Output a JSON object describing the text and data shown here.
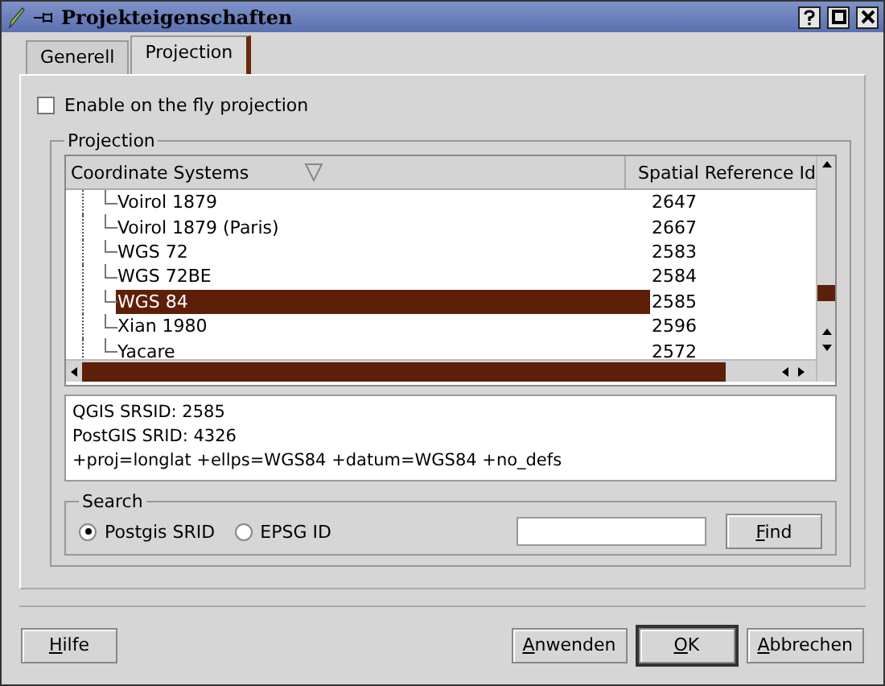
{
  "window": {
    "title": "Projekteigenschaften"
  },
  "tabs": [
    {
      "label": "Generell",
      "selected": false
    },
    {
      "label": "Projection",
      "selected": true
    }
  ],
  "on_the_fly": {
    "label": "Enable on the fly projection",
    "checked": false
  },
  "projection": {
    "title": "Projection",
    "columns": [
      "Coordinate Systems",
      "Spatial Reference Id"
    ],
    "rows": [
      {
        "name": "Voirol 1879",
        "srid": "2647",
        "selected": false
      },
      {
        "name": "Voirol 1879 (Paris)",
        "srid": "2667",
        "selected": false
      },
      {
        "name": "WGS 72",
        "srid": "2583",
        "selected": false
      },
      {
        "name": "WGS 72BE",
        "srid": "2584",
        "selected": false
      },
      {
        "name": "WGS 84",
        "srid": "2585",
        "selected": true
      },
      {
        "name": "Xian 1980",
        "srid": "2596",
        "selected": false
      },
      {
        "name": "Yacare",
        "srid": "2572",
        "selected": false
      }
    ],
    "info": [
      "QGIS SRSID: 2585",
      "PostGIS SRID: 4326",
      "+proj=longlat +ellps=WGS84 +datum=WGS84 +no_defs"
    ]
  },
  "search": {
    "title": "Search",
    "options": [
      {
        "label": "Postgis SRID",
        "selected": true
      },
      {
        "label": "EPSG ID",
        "selected": false
      }
    ],
    "button": "Find"
  },
  "buttons": [
    {
      "label": "Hilfe",
      "default": false
    },
    {
      "label": "Anwenden",
      "default": false
    },
    {
      "label": "OK",
      "default": true
    },
    {
      "label": "Abbrechen",
      "default": false
    }
  ]
}
